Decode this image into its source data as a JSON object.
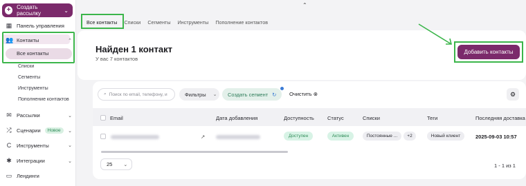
{
  "sidebar": {
    "create_label": "Создать рассылку",
    "items": [
      {
        "label": "Панель управления",
        "icon": "dashboard-icon"
      },
      {
        "label": "Контакты",
        "icon": "contacts-icon"
      },
      {
        "label": "Рассылки",
        "icon": "mail-icon"
      },
      {
        "label": "Сценарии",
        "icon": "scenarios-icon",
        "badge": "Новое"
      },
      {
        "label": "Инструменты",
        "icon": "tools-icon"
      },
      {
        "label": "Интеграции",
        "icon": "integrations-icon"
      },
      {
        "label": "Лендинги",
        "icon": "landing-icon"
      }
    ],
    "contacts_sub": [
      "Все контакты",
      "Списки",
      "Сегменты",
      "Инструменты",
      "Пополнение контактов"
    ]
  },
  "tabs": [
    "Все контакты",
    "Списки",
    "Сегменты",
    "Инструменты",
    "Пополнение контактов"
  ],
  "header": {
    "title": "Найден 1 контакт",
    "subtitle": "У вас 7 контактов",
    "add_button": "Добавить контакты"
  },
  "toolbar": {
    "search_placeholder": "Поиск по email, телефону, и",
    "filters": "Фильтры",
    "create_segment": "Создать сегмент",
    "clear": "Очистить"
  },
  "table": {
    "columns": [
      "Email",
      "Дата добавления",
      "Доступность",
      "Статус",
      "Списки",
      "Теги",
      "Последняя доставка"
    ],
    "row": {
      "availability": "Доступен",
      "status": "Активен",
      "lists": "Постоянные ...",
      "lists_more": "+2",
      "tag": "Новый клиент",
      "last_delivery": "2025-09-03 10:57"
    }
  },
  "pagination": {
    "page_size": "25",
    "info": "1 - 1 из 1"
  },
  "colors": {
    "brand": "#7b2a6b",
    "highlight": "#3bb54a",
    "green_pill": "#d8f3e6"
  }
}
